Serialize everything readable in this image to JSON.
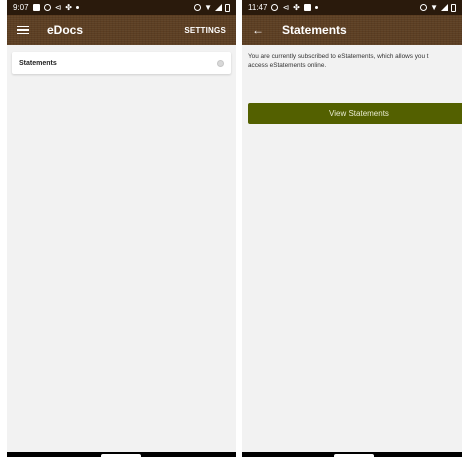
{
  "left": {
    "status": {
      "time": "9:07"
    },
    "appbar": {
      "title": "eDocs",
      "action": "SETTINGS"
    },
    "list": [
      {
        "label": "Statements"
      }
    ]
  },
  "right": {
    "status": {
      "time": "11:47"
    },
    "appbar": {
      "title": "Statements"
    },
    "message": {
      "line1": "You are currently subscribed to eStatements, which allows you t",
      "line2": "access eStatements online."
    },
    "button": {
      "label": "View Statements"
    }
  },
  "colors": {
    "appbar": "#5c3e22",
    "statusbar": "#2a1a0c",
    "button": "#536000",
    "background": "#f2f2f2"
  },
  "icons": {
    "left_menu": "hamburger-icon",
    "right_back": "back-arrow-icon",
    "list_indicator": "radio-dot-icon"
  }
}
